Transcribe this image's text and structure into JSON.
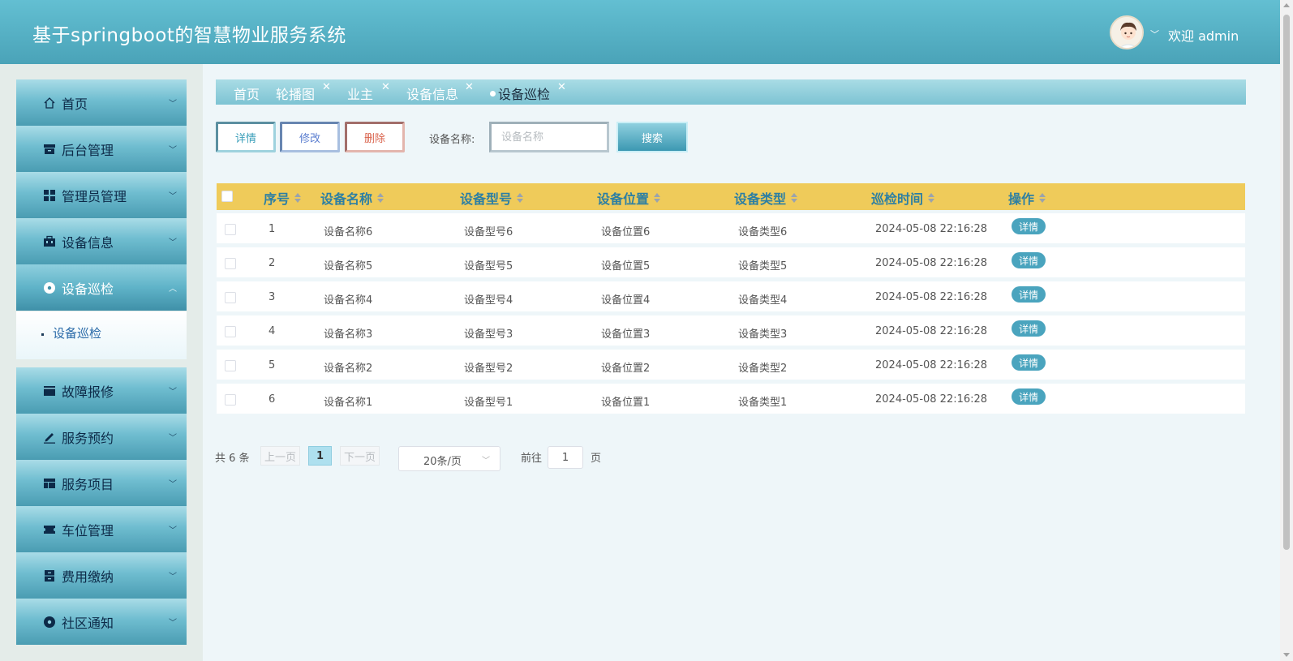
{
  "header": {
    "title": "基于springboot的智慧物业服务系统",
    "welcome": "欢迎 admin"
  },
  "sidebar": {
    "items": [
      {
        "label": "首页",
        "icon": "home-icon"
      },
      {
        "label": "后台管理",
        "icon": "archive-icon"
      },
      {
        "label": "管理员管理",
        "icon": "grid-icon"
      },
      {
        "label": "设备信息",
        "icon": "toolbox-icon"
      },
      {
        "label": "设备巡检",
        "icon": "disc-icon"
      },
      {
        "label": "故障报修",
        "icon": "card-icon"
      },
      {
        "label": "服务预约",
        "icon": "pen-icon"
      },
      {
        "label": "服务项目",
        "icon": "layout-icon"
      },
      {
        "label": "车位管理",
        "icon": "ticket-icon"
      },
      {
        "label": "费用缴纳",
        "icon": "storage-icon"
      },
      {
        "label": "社区通知",
        "icon": "record-icon"
      }
    ],
    "submenu": {
      "label": "设备巡检"
    }
  },
  "tabs": [
    {
      "label": "首页"
    },
    {
      "label": "轮播图"
    },
    {
      "label": "业主"
    },
    {
      "label": "设备信息"
    },
    {
      "label": "设备巡检"
    }
  ],
  "toolbar": {
    "detail_label": "详情",
    "edit_label": "修改",
    "delete_label": "删除",
    "search_label": "设备名称:",
    "search_placeholder": "设备名称",
    "search_button": "搜索"
  },
  "table": {
    "columns": [
      "序号",
      "设备名称",
      "设备型号",
      "设备位置",
      "设备类型",
      "巡检时间",
      "操作"
    ],
    "rows": [
      {
        "no": "1",
        "name": "设备名称6",
        "model": "设备型号6",
        "location": "设备位置6",
        "type": "设备类型6",
        "time": "2024-05-08 22:16:28",
        "action": "详情"
      },
      {
        "no": "2",
        "name": "设备名称5",
        "model": "设备型号5",
        "location": "设备位置5",
        "type": "设备类型5",
        "time": "2024-05-08 22:16:28",
        "action": "详情"
      },
      {
        "no": "3",
        "name": "设备名称4",
        "model": "设备型号4",
        "location": "设备位置4",
        "type": "设备类型4",
        "time": "2024-05-08 22:16:28",
        "action": "详情"
      },
      {
        "no": "4",
        "name": "设备名称3",
        "model": "设备型号3",
        "location": "设备位置3",
        "type": "设备类型3",
        "time": "2024-05-08 22:16:28",
        "action": "详情"
      },
      {
        "no": "5",
        "name": "设备名称2",
        "model": "设备型号2",
        "location": "设备位置2",
        "type": "设备类型2",
        "time": "2024-05-08 22:16:28",
        "action": "详情"
      },
      {
        "no": "6",
        "name": "设备名称1",
        "model": "设备型号1",
        "location": "设备位置1",
        "type": "设备类型1",
        "time": "2024-05-08 22:16:28",
        "action": "详情"
      }
    ]
  },
  "pagination": {
    "total": "共 6 条",
    "prev": "上一页",
    "page": "1",
    "next": "下一页",
    "page_size": "20条/页",
    "goto_label": "前往",
    "goto_value": "1",
    "goto_suffix": "页"
  },
  "colors": {
    "header": "#4aa3b8",
    "table_header": "#efcb5a",
    "accent": "#3b9fba",
    "delete": "#d9634c"
  }
}
